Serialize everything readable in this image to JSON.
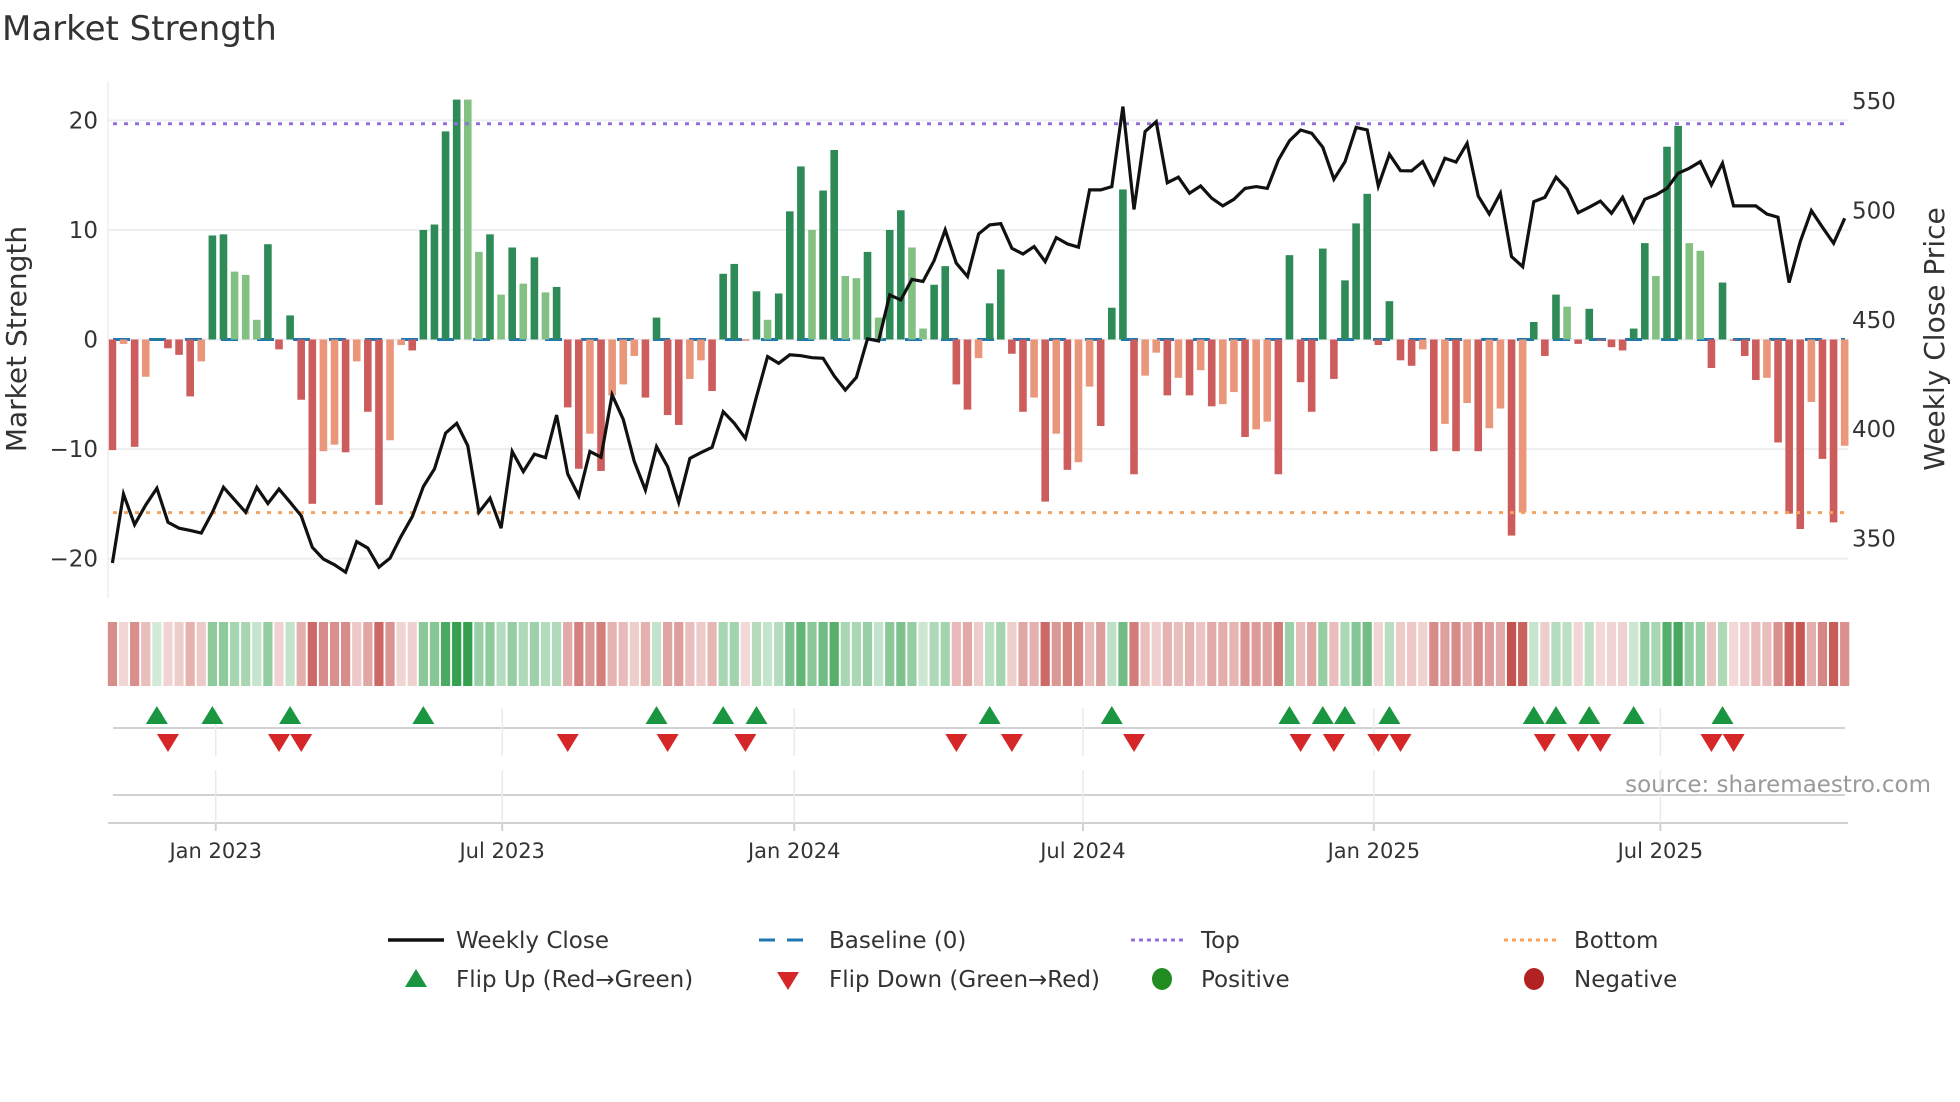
{
  "chart_data": {
    "type": "bar",
    "title": "Market Strength",
    "ylabel": "Market Strength",
    "ylabel_right": "Weekly Close Price",
    "ylim": [
      -23.6,
      23.6
    ],
    "ylim_right": [
      322.8,
      559.2
    ],
    "xlim": [
      -0.4,
      156.3
    ],
    "yticks": [
      {
        "value": 20,
        "label": "20"
      },
      {
        "value": 10,
        "label": "10"
      },
      {
        "value": 0,
        "label": "0"
      },
      {
        "value": -10,
        "label": "−10"
      },
      {
        "value": -20,
        "label": "−20"
      }
    ],
    "yticks_right": [
      {
        "value": 550,
        "label": "550"
      },
      {
        "value": 500,
        "label": "500"
      },
      {
        "value": 450,
        "label": "450"
      },
      {
        "value": 400,
        "label": "400"
      },
      {
        "value": 350,
        "label": "350"
      }
    ],
    "xticks": [
      {
        "label": "Jan 2023",
        "week_index": 9.3
      },
      {
        "label": "Jul 2023",
        "week_index": 35.1
      },
      {
        "label": "Jan 2024",
        "week_index": 61.4
      },
      {
        "label": "Jul 2024",
        "week_index": 87.4
      },
      {
        "label": "Jan 2025",
        "week_index": 113.6
      },
      {
        "label": "Jul 2025",
        "week_index": 139.4
      }
    ],
    "top_level": 19.7,
    "bottom_level": -15.8,
    "baseline": 0,
    "strength": [
      -10.1,
      -0.4,
      -9.8,
      -3.4,
      0.1,
      -0.8,
      -1.4,
      -5.2,
      -2.0,
      9.5,
      9.6,
      6.2,
      5.9,
      1.8,
      8.7,
      -0.9,
      2.2,
      -5.5,
      -15.0,
      -10.2,
      -9.6,
      -10.3,
      -2.0,
      -6.6,
      -15.1,
      -9.2,
      -0.5,
      -1.0,
      10.0,
      10.5,
      19.0,
      21.9,
      21.9,
      8.0,
      9.6,
      4.1,
      8.4,
      5.1,
      7.5,
      4.3,
      4.8,
      -6.2,
      -11.8,
      -8.6,
      -12.0,
      -5.1,
      -4.1,
      -1.5,
      -5.3,
      2.0,
      -6.9,
      -7.8,
      -3.6,
      -1.9,
      -4.7,
      6.0,
      6.9,
      -0.1,
      4.4,
      1.8,
      4.2,
      11.7,
      15.8,
      10.0,
      13.6,
      17.3,
      5.8,
      5.6,
      8.0,
      2.0,
      10.0,
      11.8,
      8.4,
      1.0,
      5.0,
      6.7,
      -4.1,
      -6.4,
      -1.7,
      3.3,
      6.4,
      -1.3,
      -6.6,
      -5.3,
      -14.8,
      -8.6,
      -11.9,
      -11.2,
      -4.3,
      -7.9,
      2.9,
      13.7,
      -12.3,
      -3.3,
      -1.2,
      -5.1,
      -3.5,
      -5.1,
      -2.8,
      -6.1,
      -5.9,
      -4.8,
      -8.9,
      -8.2,
      -7.5,
      -12.3,
      7.7,
      -3.9,
      -6.6,
      8.3,
      -3.6,
      5.4,
      10.6,
      13.3,
      -0.5,
      3.5,
      -1.9,
      -2.4,
      -0.9,
      -10.2,
      -7.7,
      -10.2,
      -5.8,
      -10.2,
      -8.1,
      -6.3,
      -17.9,
      -15.8,
      1.6,
      -1.5,
      4.1,
      3.0,
      -0.4,
      2.8,
      -0.1,
      -0.7,
      -1.0,
      1.0,
      8.8,
      5.8,
      17.6,
      19.5,
      8.8,
      8.1,
      -2.6,
      5.2,
      -0.1,
      -1.5,
      -3.7,
      -3.5,
      -9.4,
      -15.9,
      -17.3,
      -5.7,
      -10.9,
      -16.7,
      -9.7
    ],
    "weekly_close": [
      338.8,
      370.3,
      356.3,
      365.4,
      373,
      357.4,
      354.7,
      353.7,
      352.5,
      362,
      373.4,
      367.7,
      362,
      373.4,
      366,
      372.6,
      366.6,
      360.4,
      346,
      340.6,
      338,
      334.6,
      348.6,
      345.6,
      336.9,
      341,
      351,
      360,
      373.8,
      381.9,
      398.2,
      402.7,
      392.4,
      362,
      368.5,
      354.7,
      389.8,
      380.6,
      388.6,
      387,
      406.5,
      379.5,
      369.5,
      389.8,
      387.2,
      415.7,
      404.5,
      385.2,
      372.2,
      392,
      382.9,
      366.6,
      386.7,
      389.3,
      391.7,
      408,
      402.7,
      395.8,
      414.9,
      433.2,
      430.1,
      434,
      433.6,
      432.7,
      432.4,
      424.3,
      417.9,
      423.7,
      441.3,
      440.3,
      461.4,
      459.1,
      468.5,
      467.5,
      477.1,
      491.1,
      475.9,
      469.8,
      489.3,
      493.4,
      494,
      482.7,
      480.1,
      483.5,
      476.6,
      487.6,
      484.7,
      483.2,
      509.4,
      509.4,
      510.9,
      547.5,
      500.5,
      536.1,
      540.6,
      512.7,
      515.2,
      507.9,
      511.2,
      505.6,
      502.1,
      505.1,
      510.1,
      510.9,
      510.1,
      523.1,
      531.9,
      536.8,
      535.3,
      528.9,
      514.3,
      522.3,
      538,
      536.8,
      511.2,
      525.7,
      518.2,
      518.1,
      522.3,
      512.1,
      523.9,
      522.1,
      530.7,
      506.6,
      498.4,
      507.9,
      478.9,
      474.3,
      504,
      506,
      515.2,
      509.8,
      499,
      501.5,
      504.3,
      498.7,
      506,
      494.9,
      505.1,
      507.1,
      510.1,
      517,
      519.3,
      522.3,
      511.7,
      521.6,
      502.1,
      502.1,
      502.1,
      498.4,
      496.9,
      467,
      485.8,
      499.9,
      492.3,
      485,
      496.4
    ],
    "colors": {
      "positive_strong": "#2e8b57",
      "positive_weak": "#82c182",
      "negative_strong": "#cd5c5c",
      "negative_weak": "#e9967a",
      "line": "#111111",
      "baseline": "#1f77b4",
      "top": "#9370db",
      "bottom": "#f4a460",
      "flip_up": "#1a9641",
      "flip_down": "#d62728",
      "positive_dot": "#228b22",
      "negative_dot": "#b22222"
    },
    "legend": {
      "placement": "bottom-center",
      "weekly_close": "Weekly Close",
      "baseline": "Baseline (0)",
      "top": "Top",
      "bottom": "Bottom",
      "flip_up": "Flip Up (Red→Green)",
      "flip_down": "Flip Down (Green→Red)",
      "positive": "Positive",
      "negative": "Negative"
    },
    "source": "source: sharemaestro.com"
  }
}
